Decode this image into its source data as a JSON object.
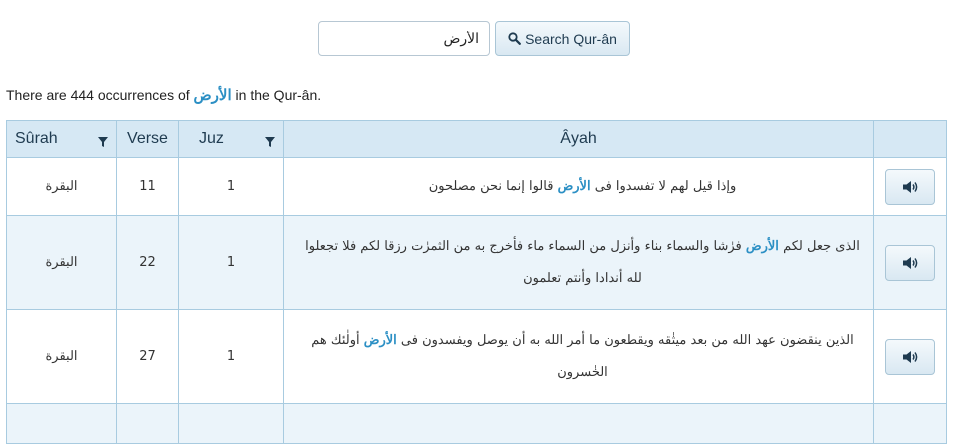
{
  "search": {
    "query": "الأرض",
    "button_label": "Search Qur-ân"
  },
  "occurrence": {
    "prefix": "There are 444 occurrences of",
    "term": "الأرض",
    "suffix": "in the Qur-ân."
  },
  "table": {
    "headers": {
      "surah": "Sûrah",
      "verse": "Verse",
      "juz": "Juz",
      "ayah": "Âyah"
    },
    "rows": [
      {
        "surah": "البقرة",
        "verse": "11",
        "juz": "1",
        "ayah_before": "وإذا قيل لهم لا تفسدوا فى",
        "ayah_match": "الأرض",
        "ayah_after": "قالوا إنما نحن مصلحون"
      },
      {
        "surah": "البقرة",
        "verse": "22",
        "juz": "1",
        "ayah_before": "الذى جعل لكم",
        "ayah_match": "الأرض",
        "ayah_after": "فرٰشا والسماء بناء وأنزل من السماء ماء فأخرج به من الثمرٰت رزقا لكم فلا تجعلوا لله أندادا وأنتم تعلمون"
      },
      {
        "surah": "البقرة",
        "verse": "27",
        "juz": "1",
        "ayah_before": "الذين ينقضون عهد الله من بعد ميثٰقه ويقطعون ما أمر الله به أن يوصل ويفسدون فى",
        "ayah_match": "الأرض",
        "ayah_after": "أولٰئك هم الخٰسرون"
      }
    ]
  },
  "colors": {
    "accent": "#2b8fc4",
    "header_bg": "#d6e8f4",
    "row_alt_bg": "#ebf4fa",
    "border": "#a8cbe0"
  },
  "icons": {
    "search": "magnifier-icon",
    "filter": "funnel-icon",
    "audio": "speaker-icon"
  }
}
